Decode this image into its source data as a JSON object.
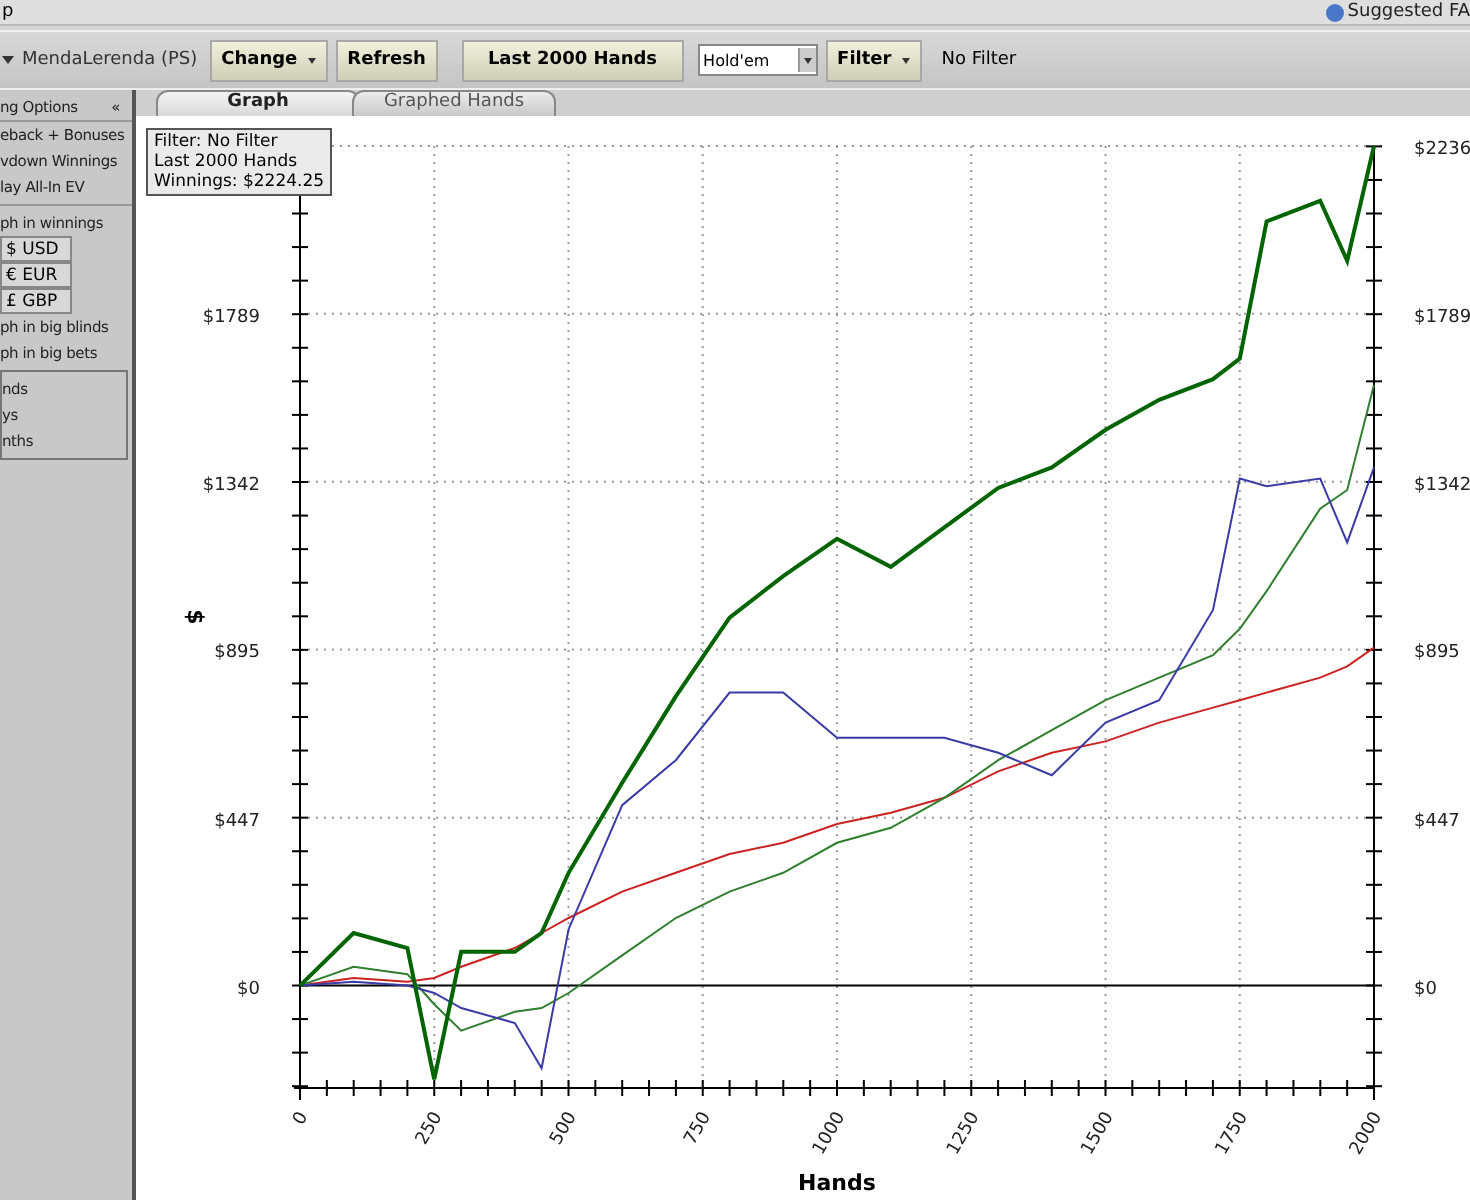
{
  "title_bar": {
    "title": "p",
    "help_link": "Suggested FA"
  },
  "toolbar": {
    "player": "MendaLerenda (PS)",
    "change_button": "Change",
    "refresh_button": "Refresh",
    "range_button": "Last  2000 Hands",
    "game_select": "Hold'em",
    "filter_button": "Filter",
    "filter_status": "No Filter"
  },
  "sidebar": {
    "header": "ng Options",
    "collapse": "«",
    "options": [
      {
        "kind": "check",
        "label": "eback + Bonuses"
      },
      {
        "kind": "check",
        "label": "vdown Winnings"
      },
      {
        "kind": "check",
        "label": "lay All-In EV"
      },
      {
        "kind": "divider"
      },
      {
        "kind": "check",
        "label": "ph in winnings"
      },
      {
        "kind": "button",
        "label": "$ USD"
      },
      {
        "kind": "button",
        "label": "€ EUR"
      },
      {
        "kind": "button",
        "label": "£ GBP"
      },
      {
        "kind": "check",
        "label": "ph in big blinds"
      },
      {
        "kind": "check",
        "label": "ph in big bets"
      }
    ],
    "group": [
      "nds",
      "ys",
      "nths"
    ]
  },
  "tabs": [
    {
      "label": "Graph",
      "selected": true
    },
    {
      "label": "Graphed Hands",
      "selected": false
    }
  ],
  "info_box": [
    "Filter: No Filter",
    "Last  2000 Hands",
    "Winnings: $2224.25"
  ],
  "chart": {
    "chart_data": {
      "type": "line",
      "grid": true,
      "xlabel": "Hands",
      "ylabel": "$",
      "xlim": [
        0,
        2000
      ],
      "ylim": [
        -273,
        2236
      ],
      "xticks": [
        0,
        250,
        500,
        750,
        1000,
        1250,
        1500,
        1750,
        2000
      ],
      "yticks": [
        {
          "value": 0,
          "label": "$0"
        },
        {
          "value": 447,
          "label": "$447"
        },
        {
          "value": 895,
          "label": "$895"
        },
        {
          "value": 1342,
          "label": "$1342"
        },
        {
          "value": 1789,
          "label": "$1789"
        },
        {
          "value": 2236,
          "label": "$2236"
        }
      ],
      "x": [
        0,
        100,
        200,
        250,
        300,
        400,
        450,
        500,
        600,
        700,
        800,
        900,
        1000,
        1100,
        1200,
        1300,
        1400,
        1500,
        1600,
        1700,
        1750,
        1800,
        1900,
        1950,
        2000
      ],
      "series": [
        {
          "color": "#006400",
          "values": [
            0,
            140,
            100,
            -250,
            90,
            90,
            140,
            300,
            540,
            770,
            980,
            1090,
            1190,
            1115,
            1220,
            1325,
            1380,
            1480,
            1560,
            1615,
            1670,
            2035,
            2090,
            1930,
            2236
          ]
        },
        {
          "color": "#3a3aa8",
          "values": [
            0,
            10,
            0,
            -20,
            -60,
            -100,
            -220,
            150,
            480,
            600,
            780,
            780,
            660,
            660,
            660,
            620,
            560,
            700,
            760,
            1000,
            1350,
            1330,
            1350,
            1180,
            1380
          ]
        },
        {
          "color": "#2f7f2f",
          "values": [
            0,
            50,
            30,
            -50,
            -120,
            -70,
            -60,
            -20,
            80,
            180,
            250,
            300,
            380,
            420,
            500,
            600,
            680,
            760,
            820,
            880,
            950,
            1050,
            1270,
            1320,
            1600
          ]
        },
        {
          "color": "#cc2222",
          "values": [
            0,
            20,
            10,
            20,
            50,
            100,
            140,
            180,
            250,
            300,
            350,
            380,
            430,
            460,
            500,
            570,
            620,
            650,
            700,
            740,
            760,
            780,
            820,
            850,
            900
          ]
        }
      ]
    }
  }
}
